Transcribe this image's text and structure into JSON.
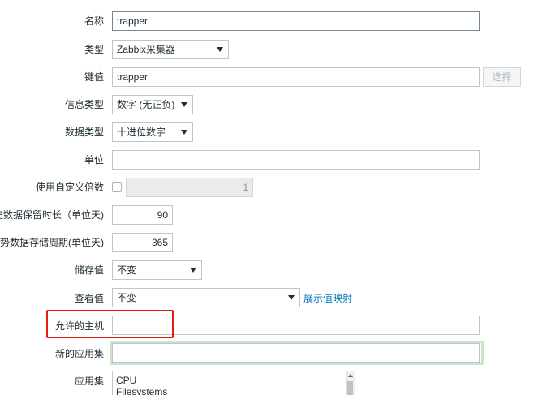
{
  "form": {
    "name": {
      "label": "名称",
      "value": "trapper"
    },
    "type": {
      "label": "类型",
      "value": "Zabbix采集器"
    },
    "key": {
      "label": "键值",
      "value": "trapper",
      "select_button": "选择"
    },
    "info_type": {
      "label": "信息类型",
      "value": "数字 (无正负)"
    },
    "data_type": {
      "label": "数据类型",
      "value": "十进位数字"
    },
    "units": {
      "label": "单位",
      "value": ""
    },
    "multiplier": {
      "label": "使用自定义倍数",
      "value": "1",
      "checked": false
    },
    "history": {
      "label": "史数据保留时长（单位天)",
      "value": "90"
    },
    "trends": {
      "label": "势数据存储周期(单位天)",
      "value": "365"
    },
    "store_value": {
      "label": "储存值",
      "value": "不变"
    },
    "show_value": {
      "label": "查看值",
      "value": "不变",
      "link": "展示值映射"
    },
    "allowed_hosts": {
      "label": "允许的主机",
      "value": ""
    },
    "new_application": {
      "label": "新的应用集",
      "value": ""
    },
    "applications": {
      "label": "应用集",
      "options": [
        "CPU",
        "Filesystems"
      ]
    }
  },
  "colors": {
    "highlight": "#e8190f",
    "focus_glow": "#cbe3c8",
    "link": "#0275b8"
  }
}
